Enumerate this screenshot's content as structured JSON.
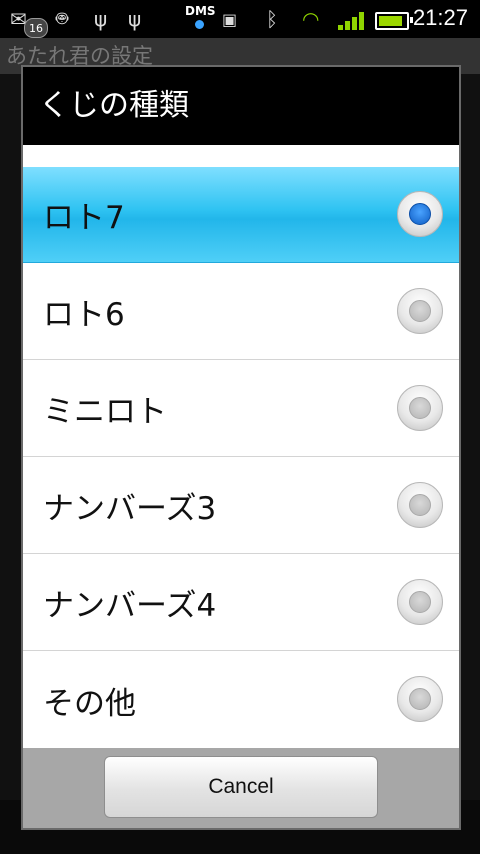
{
  "status_bar": {
    "notification_count": "16",
    "dms_label": "DMS",
    "time": "21:27",
    "icons": [
      "mail-icon",
      "android-icon",
      "usb-icon",
      "usb-debug-icon",
      "dms-icon",
      "sd-card-icon",
      "bluetooth-icon",
      "wifi-icon",
      "signal-icon",
      "battery-icon"
    ]
  },
  "background_app": {
    "title": "あたれ君の設定"
  },
  "dialog": {
    "title": "くじの種類",
    "options": [
      {
        "label": "ロト7",
        "selected": true
      },
      {
        "label": "ロト6",
        "selected": false
      },
      {
        "label": "ミニロト",
        "selected": false
      },
      {
        "label": "ナンバーズ3",
        "selected": false
      },
      {
        "label": "ナンバーズ4",
        "selected": false
      },
      {
        "label": "その他",
        "selected": false
      }
    ],
    "cancel_label": "Cancel"
  },
  "colors": {
    "selected_row": "#2fc3f2",
    "radio_checked": "#0f5dc4"
  }
}
